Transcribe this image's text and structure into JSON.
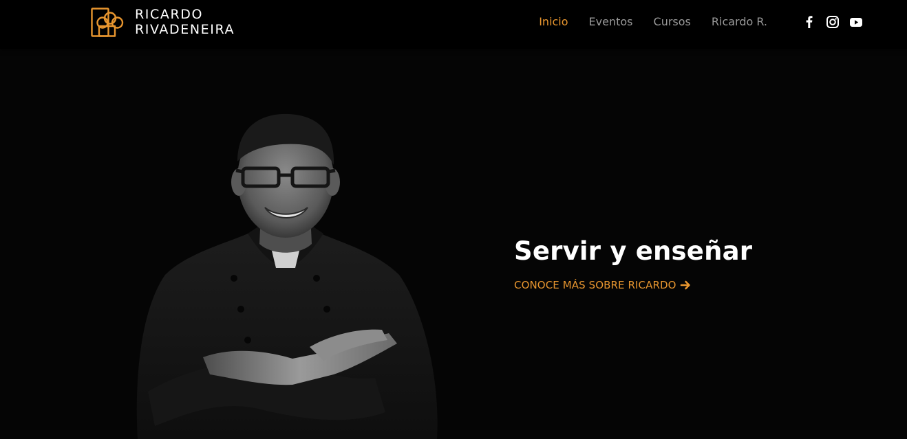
{
  "brand": {
    "line1": "RICARDO",
    "line2": "RIVADENEIRA",
    "logo_icon": "chef-hat-logo-icon",
    "accent_color": "#e8962f"
  },
  "nav": {
    "items": [
      {
        "label": "Inicio",
        "active": true
      },
      {
        "label": "Eventos",
        "active": false
      },
      {
        "label": "Cursos",
        "active": false
      },
      {
        "label": "Ricardo R.",
        "active": false
      }
    ]
  },
  "social": {
    "icons": [
      "facebook-icon",
      "instagram-icon",
      "youtube-icon"
    ]
  },
  "hero": {
    "title": "Servir y enseñar",
    "cta_label": "CONOCE MÁS SOBRE RICARDO",
    "cta_icon": "arrow-right-icon",
    "photo": "chef-portrait-photo"
  },
  "colors": {
    "background": "#050505",
    "header": "#000000",
    "nav_inactive": "#9a9a9a",
    "accent": "#e8962f",
    "text": "#ffffff"
  }
}
